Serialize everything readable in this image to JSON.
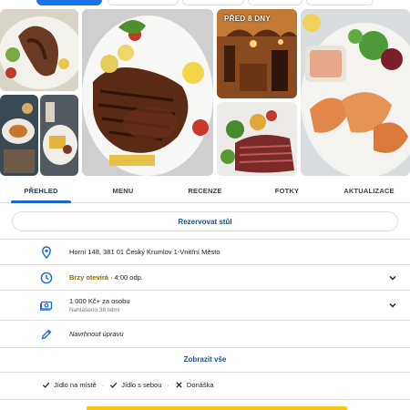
{
  "gallery": {
    "badge": "PŘED 8 DNY",
    "photos": [
      {
        "name": "photo-octopus-plate"
      },
      {
        "name": "photo-steak-main"
      },
      {
        "name": "photo-restaurant-interior"
      },
      {
        "name": "photo-sliced-beef-vegetables"
      },
      {
        "name": "photo-shrimp-salad"
      },
      {
        "name": "photo-table-dishes"
      },
      {
        "name": "photo-fries-plate"
      }
    ]
  },
  "tabs": [
    {
      "label": "PŘEHLED",
      "active": true
    },
    {
      "label": "MENU",
      "active": false
    },
    {
      "label": "RECENZE",
      "active": false
    },
    {
      "label": "FOTKY",
      "active": false
    },
    {
      "label": "AKTUALIZACE",
      "active": false
    }
  ],
  "reserve_label": "Rezervovat stůl",
  "address": {
    "icon": "location-pin-icon",
    "text": "Horní 148, 381 01 Český Krumlov 1-Vnitřní Město"
  },
  "hours": {
    "icon": "clock-icon",
    "status": "Brzy otevírá",
    "separator": " · ",
    "time": "4:00 odp."
  },
  "price": {
    "icon": "money-icon",
    "text": "1 000 Kč+ za osobu",
    "sub": "Nahlášeno 38 lidmi"
  },
  "suggest": {
    "icon": "pencil-icon",
    "text": "Navrhnout úpravu"
  },
  "show_all_label": "Zobrazit vše",
  "services": [
    {
      "label": "Jídlo na místě",
      "available": true
    },
    {
      "label": "Jídlo s sebou",
      "available": true
    },
    {
      "label": "Donáška",
      "available": false
    }
  ],
  "colors": {
    "accent": "#1967d2",
    "link": "#1a4f8b",
    "status_open_soon": "#8a6d00",
    "bottom_bar": "#f5c518"
  }
}
